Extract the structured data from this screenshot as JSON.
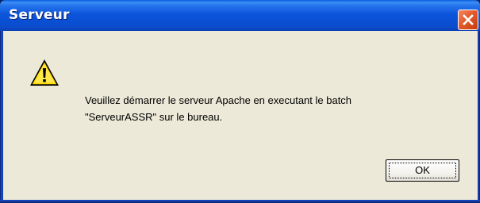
{
  "window": {
    "title": "Serveur",
    "close_icon": "close-icon"
  },
  "dialog": {
    "icon": "warning-icon",
    "message_lines": [
      "Veuillez démarrer le serveur Apache en executant le batch",
      "\"ServeurASSR\" sur le bureau."
    ],
    "ok_label": "OK"
  },
  "colors": {
    "titlebar": "#0a4fd3",
    "client_background": "#ece9d8",
    "close_button": "#e35b2c",
    "warning_yellow": "#ffd700"
  }
}
